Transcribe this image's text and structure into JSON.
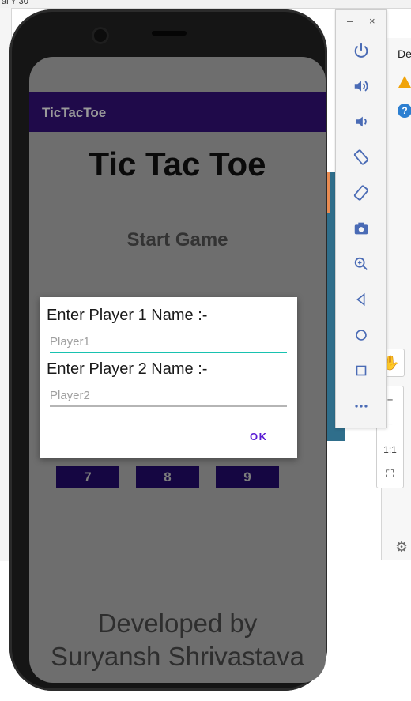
{
  "ide": {
    "top_fragment": "al Y 30",
    "panel_label": "De",
    "zoom_buttons": [
      "+",
      "−",
      "1:1",
      "⛶"
    ]
  },
  "app": {
    "app_bar_title": "TicTacToe",
    "game_title": "Tic Tac Toe",
    "start_game_label": "Start Game",
    "grid_row": [
      "7",
      "8",
      "9"
    ],
    "footer_line1": "Developed by",
    "footer_line2": "Suryansh Shrivastava"
  },
  "dialog": {
    "player1_label": "Enter Player 1 Name :-",
    "player1_placeholder": "Player1",
    "player1_value": "",
    "player2_label": "Enter Player 2 Name :-",
    "player2_placeholder": "Player2",
    "player2_value": "",
    "ok_label": "OK"
  },
  "emulator_toolbar": {
    "minimize_label": "–",
    "close_label": "×",
    "buttons": [
      "power-icon",
      "volume-up-icon",
      "volume-down-icon",
      "rotate-left-icon",
      "rotate-right-icon",
      "camera-icon",
      "zoom-icon",
      "back-icon",
      "home-icon",
      "overview-icon",
      "more-icon"
    ]
  },
  "colors": {
    "app_bar": "#1f0a4a",
    "accent_teal": "#18c2b0",
    "ok_purple": "#5a1cd4",
    "toolbar_icon": "#4a6bb5"
  }
}
